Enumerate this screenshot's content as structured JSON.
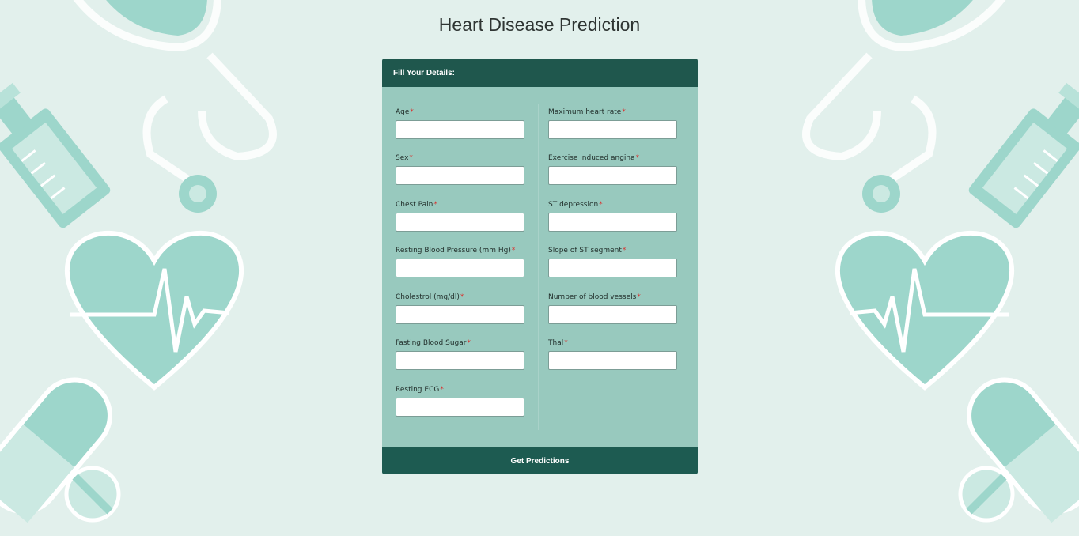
{
  "page": {
    "title": "Heart Disease Prediction"
  },
  "form": {
    "header": "Fill Your Details:",
    "required_mark": "*",
    "left_fields": [
      {
        "label": "Age",
        "value": "",
        "placeholder": ""
      },
      {
        "label": "Sex",
        "value": "",
        "placeholder": ""
      },
      {
        "label": "Chest Pain",
        "value": "",
        "placeholder": ""
      },
      {
        "label": "Resting Blood Pressure (mm Hg)",
        "value": "",
        "placeholder": ""
      },
      {
        "label": "Cholestrol (mg/dl)",
        "value": "",
        "placeholder": ""
      },
      {
        "label": "Fasting Blood Sugar",
        "value": "",
        "placeholder": ""
      },
      {
        "label": "Resting ECG",
        "value": "",
        "placeholder": ""
      }
    ],
    "right_fields": [
      {
        "label": "Maximum heart rate",
        "value": "",
        "placeholder": ""
      },
      {
        "label": "Exercise induced angina",
        "value": "",
        "placeholder": ""
      },
      {
        "label": "ST depression",
        "value": "",
        "placeholder": ""
      },
      {
        "label": "Slope of ST segment",
        "value": "",
        "placeholder": ""
      },
      {
        "label": "Number of blood vessels",
        "value": "",
        "placeholder": ""
      },
      {
        "label": "Thal",
        "value": "",
        "placeholder": ""
      }
    ],
    "submit_label": "Get Predictions"
  },
  "background": {
    "icons": [
      "stethoscope-icon",
      "syringe-icon",
      "heart-pulse-icon",
      "pill-capsule-icon",
      "tablet-pill-icon"
    ]
  },
  "colors": {
    "page_bg": "#e2f0ec",
    "card_bg": "#98c9be",
    "header_bg": "#1f574d",
    "button_bg": "#1d5b51",
    "icon_fill": "#9dd6cb",
    "required": "#d9322f"
  }
}
